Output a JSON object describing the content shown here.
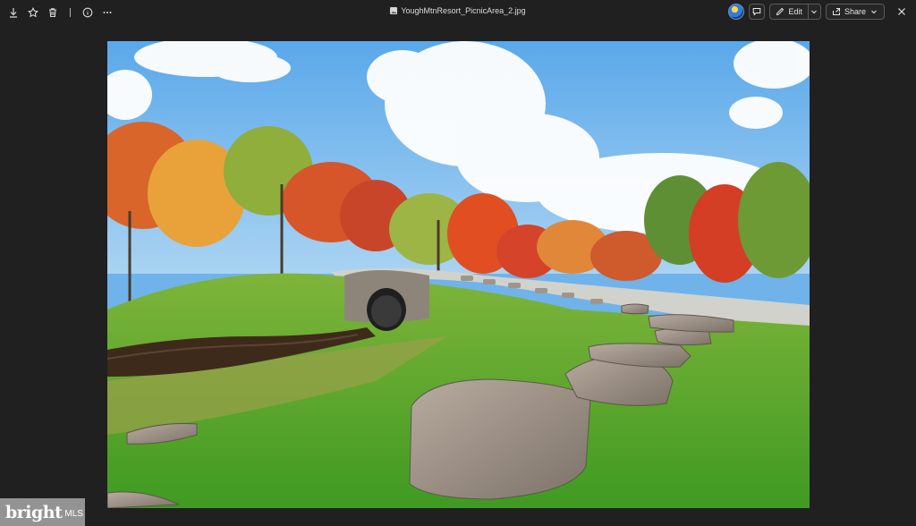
{
  "toolbar": {
    "icons": [
      "download-icon",
      "star-icon",
      "trash-icon",
      "info-icon",
      "more-icon"
    ]
  },
  "file": {
    "name": "YoughMtnResort_PicnicArea_2.jpg"
  },
  "actions": {
    "edit_label": "Edit",
    "share_label": "Share"
  },
  "watermark": {
    "brand": "bright",
    "suffix": "MLS"
  },
  "colors": {
    "background": "#202020",
    "sky": "#6fb3ea",
    "grass": "#5fae2e",
    "foliage_orange": "#e0662a",
    "foliage_yellow": "#e8b43a"
  }
}
